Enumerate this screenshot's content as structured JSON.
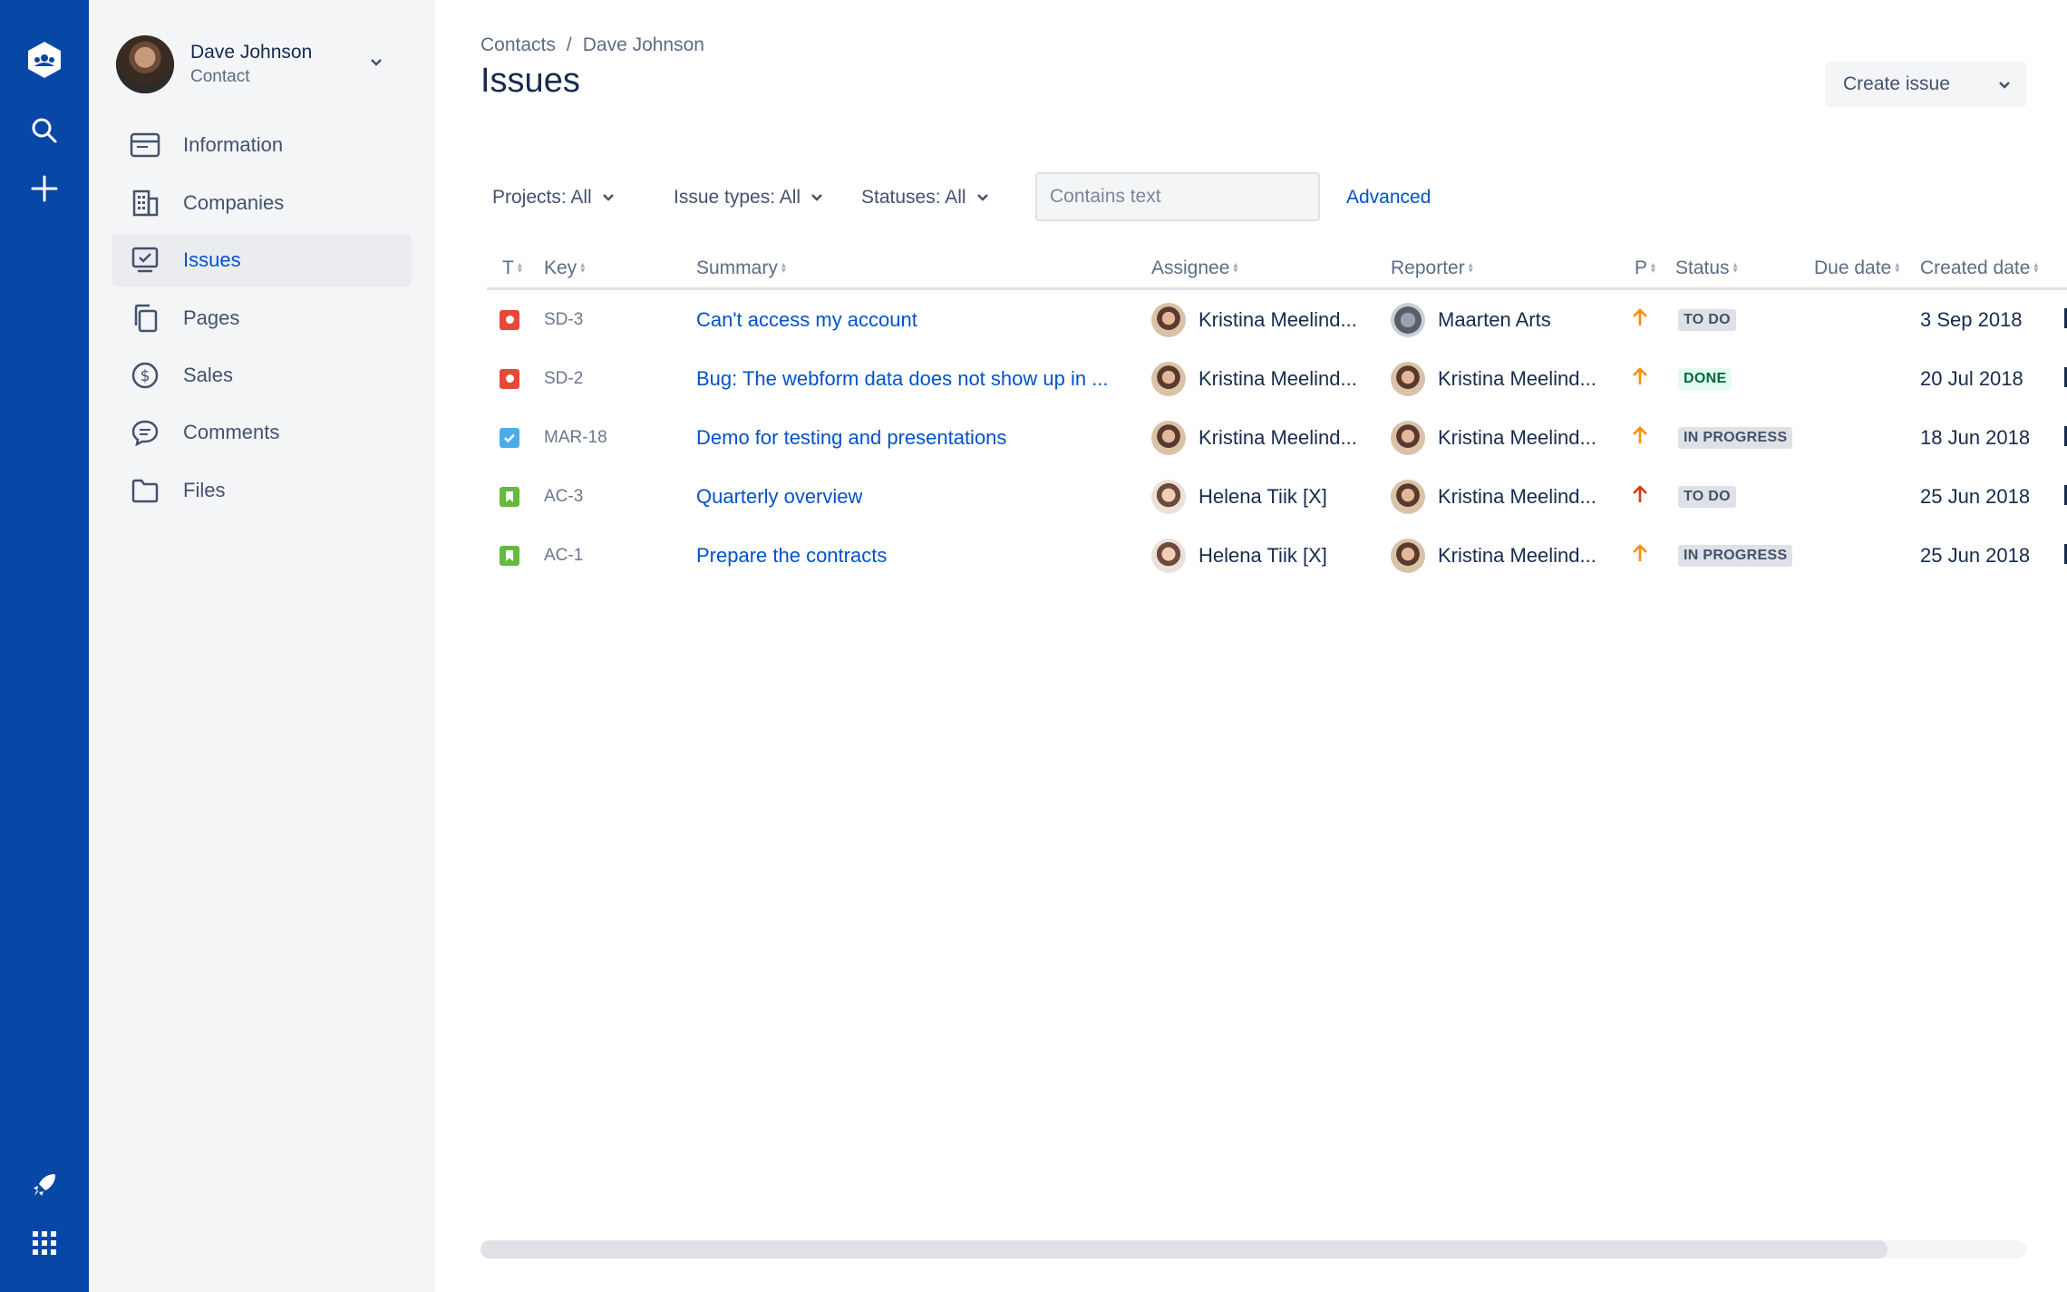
{
  "global_nav": {
    "icons": [
      "team-logo-icon",
      "search-icon",
      "plus-icon",
      "rocket-icon",
      "app-switcher-icon"
    ],
    "color": "#0747A6"
  },
  "sidebar": {
    "contact": {
      "name": "Dave Johnson",
      "role": "Contact"
    },
    "items": [
      {
        "label": "Information",
        "icon": "browser-icon"
      },
      {
        "label": "Companies",
        "icon": "building-icon"
      },
      {
        "label": "Issues",
        "icon": "issues-screen-icon",
        "active": true
      },
      {
        "label": "Pages",
        "icon": "pages-icon"
      },
      {
        "label": "Sales",
        "icon": "dollar-icon"
      },
      {
        "label": "Comments",
        "icon": "comment-icon"
      },
      {
        "label": "Files",
        "icon": "folder-icon"
      }
    ]
  },
  "header": {
    "breadcrumb": [
      "Contacts",
      "/",
      "Dave Johnson"
    ],
    "title": "Issues",
    "create_issue_label": "Create issue"
  },
  "filters": {
    "projects": "Projects: All",
    "issue_types": "Issue types: All",
    "statuses": "Statuses: All",
    "search_placeholder": "Contains text",
    "advanced": "Advanced"
  },
  "table": {
    "columns": [
      "T",
      "Key",
      "Summary",
      "Assignee",
      "Reporter",
      "P",
      "Status",
      "Due date",
      "Created date"
    ],
    "rows": [
      {
        "type": "bug",
        "key": "SD-3",
        "summary": "Can't access my account",
        "assignee": "Kristina Meelind...",
        "assignee_avatar": "kristina",
        "reporter": "Maarten Arts",
        "reporter_avatar": "maarten",
        "priority": "medium",
        "status": "TO DO",
        "status_kind": "todo",
        "due": "",
        "created": "3 Sep 2018"
      },
      {
        "type": "bug",
        "key": "SD-2",
        "summary": "Bug: The webform data does not show up in ...",
        "assignee": "Kristina Meelind...",
        "assignee_avatar": "kristina",
        "reporter": "Kristina Meelind...",
        "reporter_avatar": "kristina",
        "priority": "medium",
        "status": "DONE",
        "status_kind": "done",
        "due": "",
        "created": "20 Jul 2018"
      },
      {
        "type": "task",
        "key": "MAR-18",
        "summary": "Demo for testing and presentations",
        "assignee": "Kristina Meelind...",
        "assignee_avatar": "kristina",
        "reporter": "Kristina Meelind...",
        "reporter_avatar": "kristina",
        "priority": "medium",
        "status": "IN PROGRESS",
        "status_kind": "progress",
        "due": "",
        "created": "18 Jun 2018"
      },
      {
        "type": "story",
        "key": "AC-3",
        "summary": "Quarterly overview",
        "assignee": "Helena Tiik [X]",
        "assignee_avatar": "helena",
        "reporter": "Kristina Meelind...",
        "reporter_avatar": "kristina",
        "priority": "high",
        "status": "TO DO",
        "status_kind": "todo",
        "due": "",
        "created": "25 Jun 2018"
      },
      {
        "type": "story",
        "key": "AC-1",
        "summary": "Prepare the contracts",
        "assignee": "Helena Tiik [X]",
        "assignee_avatar": "helena",
        "reporter": "Kristina Meelind...",
        "reporter_avatar": "kristina",
        "priority": "medium",
        "status": "IN PROGRESS",
        "status_kind": "progress",
        "due": "",
        "created": "25 Jun 2018"
      }
    ]
  },
  "colors": {
    "link": "#0052CC",
    "priority_medium": "#FF8B00",
    "priority_high": "#DE350B"
  }
}
